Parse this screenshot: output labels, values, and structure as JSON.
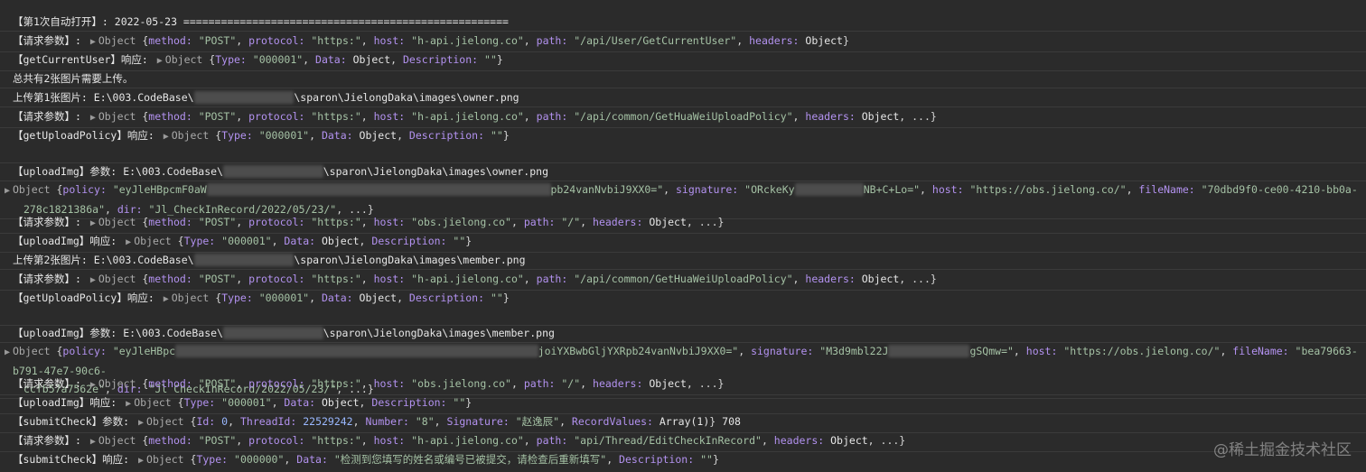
{
  "lines": {
    "l1": "【第1次自动打开】: 2022-05-23 ====================================================",
    "l4": "总共有2张图片需要上传。",
    "l5a": "上传第1张图片: E:\\003.CodeBase\\",
    "l5b": "\\sparon\\JielongDaka\\images\\owner.png",
    "l14a": "上传第2张图片: E:\\003.CodeBase\\",
    "l14b": "\\sparon\\JielongDaka\\images\\member.png"
  },
  "labels": {
    "req": "【请求参数】:",
    "getCurrentUser": "【getCurrentUser】响应:",
    "getUploadPolicy": "【getUploadPolicy】响应:",
    "uploadImgParam": "【uploadImg】参数:",
    "uploadImgResp": "【uploadImg】响应:",
    "submitCheckParam": "【submitCheck】参数:",
    "submitCheckResp": "【submitCheck】响应:"
  },
  "paths": {
    "ownerA": "E:\\003.CodeBase\\",
    "ownerB": "\\sparon\\JielongDaka\\images\\owner.png",
    "memberA": "E:\\003.CodeBase\\",
    "memberB": "\\sparon\\JielongDaka\\images\\member.png"
  },
  "tokens": {
    "object": "Object",
    "ob": "{",
    "cb": "}",
    "comma": ", ",
    "ellipsis": ", ...}",
    "method": "method:",
    "protocol": "protocol:",
    "host": "host:",
    "path": "path:",
    "headers": "headers:",
    "type": "Type:",
    "data": "Data:",
    "description": "Description:",
    "policy": "policy:",
    "signature": "signature:",
    "fileName": "fileName:",
    "dir": "dir:",
    "id": "Id:",
    "threadId": "ThreadId:",
    "number": "Number:",
    "signatureCap": "Signature:",
    "recordValues": "RecordValues:"
  },
  "values": {
    "post": "\"POST\"",
    "https": "\"https:\"",
    "hostApi": "\"h-api.jielong.co\"",
    "hostObs": "\"obs.jielong.co\"",
    "pathUser": "\"/api/User/GetCurrentUser\"",
    "pathPolicy": "\"/api/common/GetHuaWeiUploadPolicy\"",
    "pathRoot": "\"/\"",
    "pathEdit": "\"api/Thread/EditCheckInRecord\"",
    "objectWord": "Object",
    "t000001": "\"000001\"",
    "t000000": "\"000000\"",
    "empty": "\"\"",
    "policy1a": "\"eyJleHBpcmF0aW",
    "policy1b": "pb24vanNvbiJ9XX0=\"",
    "sig1a": "\"ORckeKy",
    "sig1b": "NB+C+Lo=\"",
    "obsUrl": "\"https://obs.jielong.co/\"",
    "file1": "\"70dbd9f0-ce00-4210-bb0a-",
    "file1b": "278c1821386a\"",
    "dir": "\"Jl_CheckInRecord/2022/05/23/\"",
    "policy2a": "\"eyJleHBpc",
    "policy2b": "joiYXBwbGljYXRpb24vanNvbiJ9XX0=\"",
    "sig2a": "\"M3d9mbl22J",
    "sig2b": "gSQmw=\"",
    "file2": "\"bea79663-b791-47e7-90c6-",
    "file2b": "ccfb57a7562e\"",
    "id0": "0",
    "threadId": "22529242",
    "number": "\"8\"",
    "signature": "\"赵逸辰\"",
    "array": "Array(1)",
    "count": "708",
    "submitData": "\"检测到您填写的姓名或编号已被提交，请检查后重新填写\""
  },
  "watermark": "@稀土掘金技术社区",
  "icons": {
    "expand": "chevron-right-icon"
  }
}
